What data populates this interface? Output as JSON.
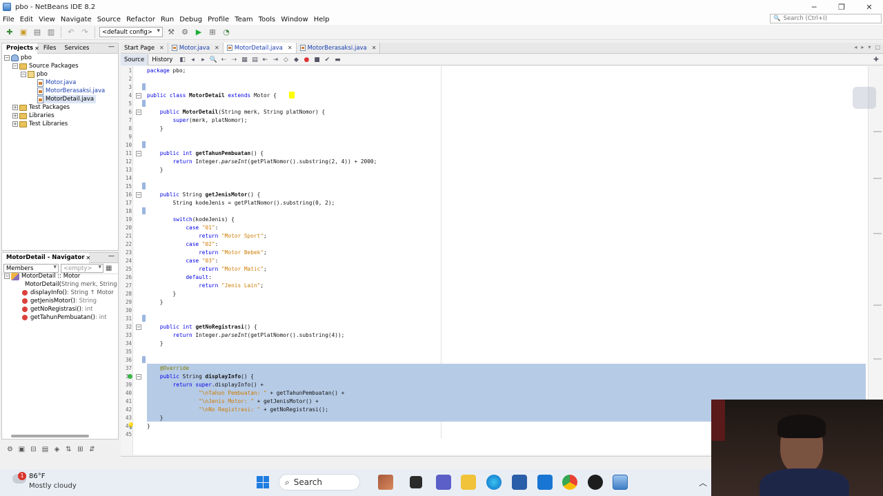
{
  "window": {
    "title": "pbo - NetBeans IDE 8.2"
  },
  "menu": [
    "File",
    "Edit",
    "View",
    "Navigate",
    "Source",
    "Refactor",
    "Run",
    "Debug",
    "Profile",
    "Team",
    "Tools",
    "Window",
    "Help"
  ],
  "search": {
    "placeholder": "Search (Ctrl+I)"
  },
  "toolbar": {
    "config": "<default config>"
  },
  "projects_panel": {
    "tabs": [
      "Projects",
      "Files",
      "Services"
    ],
    "tree": {
      "project": "pbo",
      "source_packages": "Source Packages",
      "package": "pbo",
      "files": [
        "Motor.java",
        "MotorBerasaksi.java",
        "MotorDetail.java"
      ],
      "test_packages": "Test Packages",
      "libraries": "Libraries",
      "test_libraries": "Test Libraries"
    }
  },
  "navigator": {
    "title": "MotorDetail - Navigator",
    "filter": "Members",
    "filter2": "<empty>",
    "class_label": "MotorDetail :: Motor",
    "members": [
      {
        "name": "MotorDetail(",
        "sig": "String merk, String p"
      },
      {
        "name": "displayInfo() ",
        "sig": ": String ↑ Motor"
      },
      {
        "name": "getJenisMotor() ",
        "sig": ": String"
      },
      {
        "name": "getNoRegistrasi() ",
        "sig": ": int"
      },
      {
        "name": "getTahunPembuatan() ",
        "sig": ": int"
      }
    ]
  },
  "editor": {
    "tabs": [
      "Start Page",
      "Motor.java",
      "MotorDetail.java",
      "MotorBerasaksi.java"
    ],
    "modes": [
      "Source",
      "History"
    ],
    "line_count": 45
  },
  "taskbar": {
    "weather_temp": "86°F",
    "weather_desc": "Mostly cloudy",
    "notification_count": "1",
    "search_label": "Search"
  },
  "colors": {
    "selection": "#b6cbe6",
    "keyword": "#0000e6",
    "string": "#ce7b00"
  }
}
